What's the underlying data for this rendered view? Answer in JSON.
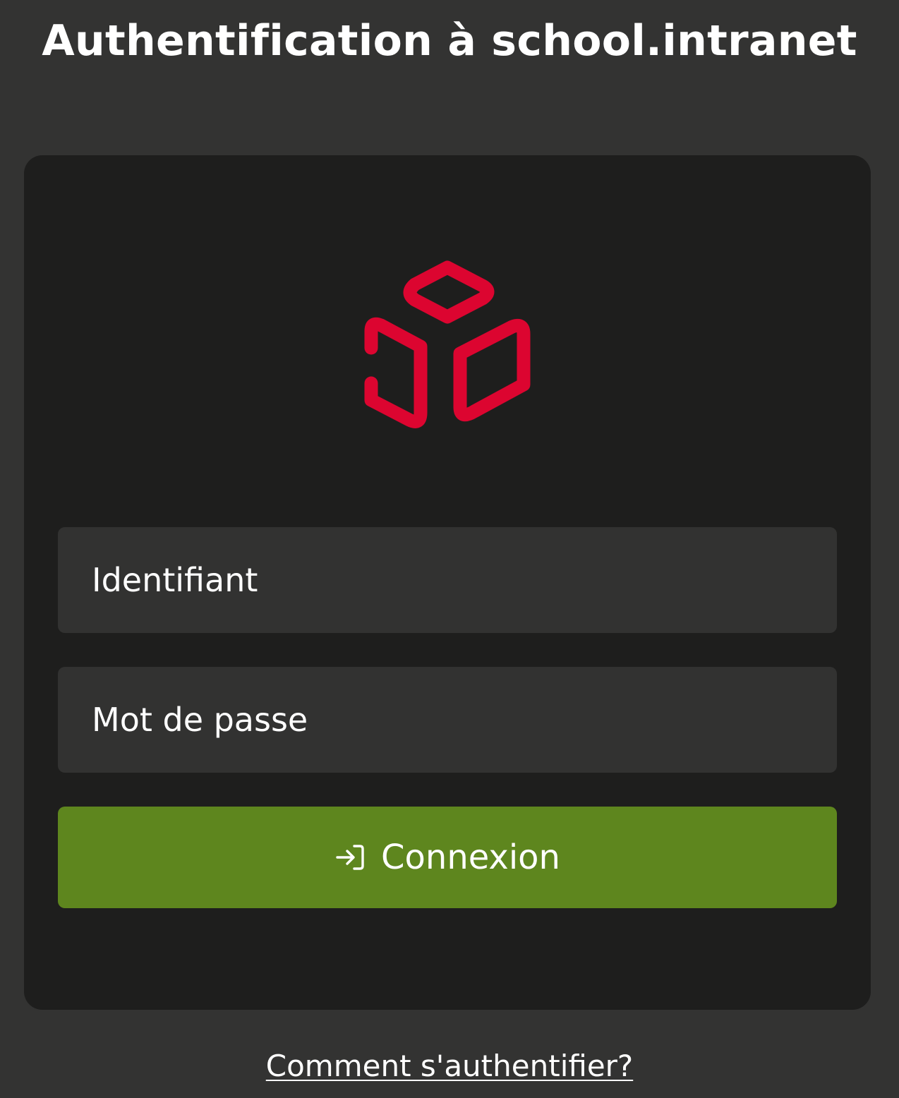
{
  "page": {
    "title": "Authentification à school.intranet",
    "background_color": "#333332"
  },
  "card": {
    "background_color": "#1e1e1d",
    "logo": {
      "icon": "cube-logo-icon",
      "color": "#dc0530"
    }
  },
  "form": {
    "username": {
      "placeholder": "Identifiant",
      "value": ""
    },
    "password": {
      "placeholder": "Mot de passe",
      "value": ""
    },
    "submit": {
      "label": "Connexion",
      "icon": "login-arrow-icon",
      "color": "#5e861e"
    }
  },
  "help": {
    "link_label": "Comment s'authentifier?"
  }
}
